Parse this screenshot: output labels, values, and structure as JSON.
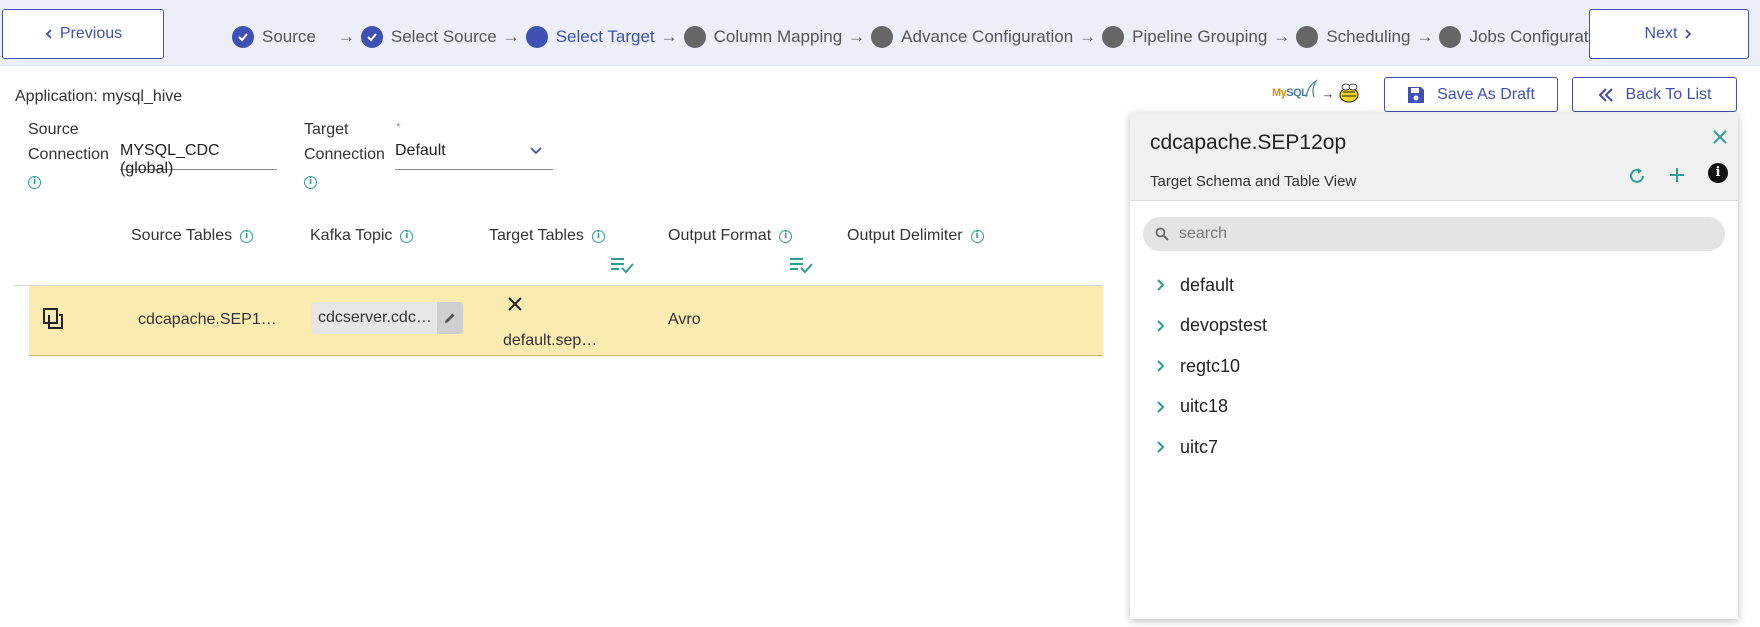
{
  "nav": {
    "previous_label": "Previous",
    "next_label": "Next"
  },
  "steps": [
    {
      "label": "Source",
      "state": "done"
    },
    {
      "label": "Select Source",
      "state": "done"
    },
    {
      "label": "Select Target",
      "state": "active"
    },
    {
      "label": "Column Mapping",
      "state": "todo"
    },
    {
      "label": "Advance Configuration",
      "state": "todo"
    },
    {
      "label": "Pipeline Grouping",
      "state": "todo"
    },
    {
      "label": "Scheduling",
      "state": "todo"
    },
    {
      "label": "Jobs Configuration",
      "state": "todo"
    }
  ],
  "application": {
    "label": "Application: mysql_hive"
  },
  "source_connection": {
    "label_line1": "Source",
    "label_line2": "Connection",
    "value": "MYSQL_CDC (global)"
  },
  "target_connection": {
    "label_line1": "Target",
    "label_line2": "Connection",
    "required": "*",
    "value": "Default"
  },
  "table": {
    "headers": {
      "source_tables": "Source Tables",
      "kafka_topic": "Kafka Topic",
      "target_tables": "Target Tables",
      "output_format": "Output Format",
      "output_delimiter": "Output Delimiter"
    },
    "rows": [
      {
        "source_table": "cdcapache.SEP1…",
        "kafka_topic": "cdcserver.cdc…",
        "target_table": "default.sep…",
        "output_format": "Avro",
        "output_delimiter": ""
      }
    ]
  },
  "actions": {
    "save_draft_label": "Save As Draft",
    "back_to_list_label": "Back To List"
  },
  "logos": {
    "source": "MySQL",
    "target": "Hive"
  },
  "panel": {
    "title": "cdcapache.SEP12op",
    "subtitle": "Target Schema and Table View",
    "search_placeholder": "search",
    "schemas": [
      "default",
      "devopstest",
      "regtc10",
      "uitc18",
      "uitc7"
    ]
  },
  "colors": {
    "primary": "#3f51b5",
    "teal": "#2e9e92",
    "row_highlight": "#fcebb1",
    "stepper_bg": "#eceef8"
  }
}
